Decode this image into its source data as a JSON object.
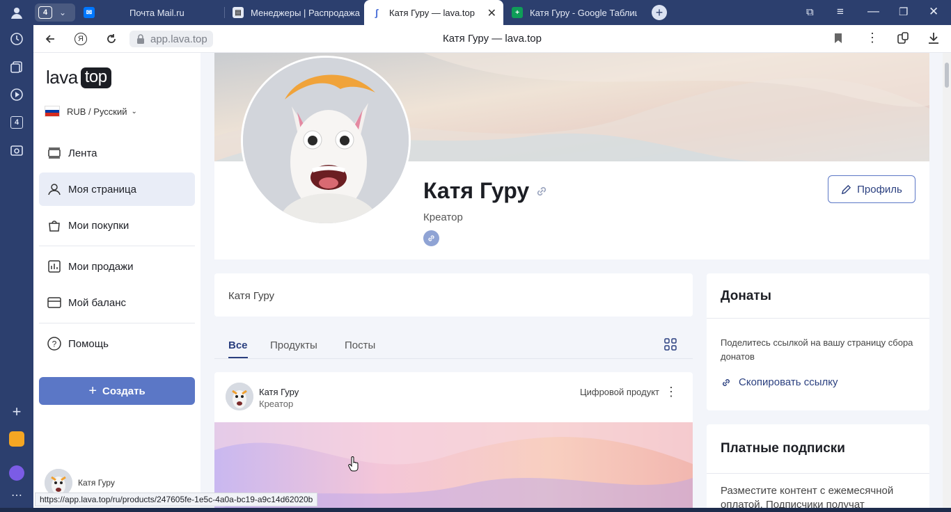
{
  "browser": {
    "tab_count": "4",
    "tabs": [
      {
        "label": "Почта Mail.ru",
        "icon": "mail-ru-icon",
        "color": "#0077ff"
      },
      {
        "label": "Менеджеры | Распродажа",
        "icon": "document-icon",
        "color": "#555555"
      },
      {
        "label": "Катя Гуру — lava.top",
        "icon": "lava-icon",
        "color": "#4a6fd8"
      },
      {
        "label": "Катя Гуру - Google Таблицы",
        "icon": "sheets-icon",
        "color": "#0f9d58"
      }
    ],
    "url": "app.lava.top",
    "page_title": "Катя Гуру — lava.top",
    "status_url": "https://app.lava.top/ru/products/247605fe-1e5c-4a0a-bc19-a9c14d62020b"
  },
  "sidebar": {
    "logo_left": "lava",
    "logo_right": "top",
    "locale": "RUB / Русский",
    "items": [
      {
        "label": "Лента",
        "icon": "feed-icon"
      },
      {
        "label": "Моя страница",
        "icon": "user-icon"
      },
      {
        "label": "Мои покупки",
        "icon": "bag-icon"
      },
      {
        "label": "Мои продажи",
        "icon": "chart-icon"
      },
      {
        "label": "Мой баланс",
        "icon": "wallet-icon"
      },
      {
        "label": "Помощь",
        "icon": "help-icon"
      }
    ],
    "create_label": "Создать",
    "user_name": "Катя Гуру"
  },
  "profile": {
    "name": "Катя Гуру",
    "role": "Креатор",
    "edit_button": "Профиль"
  },
  "about": {
    "text": "Катя Гуру"
  },
  "content_tabs": [
    "Все",
    "Продукты",
    "Посты"
  ],
  "post": {
    "author": "Катя Гуру",
    "role": "Креатор",
    "type": "Цифровой продукт"
  },
  "donations": {
    "title": "Донаты",
    "text": "Поделитесь ссылкой на вашу страницу сбора донатов",
    "copy_link": "Скопировать ссылку"
  },
  "subscriptions": {
    "title": "Платные подписки",
    "text": "Разместите контент с ежемесячной оплатой. Подписчики получат"
  },
  "colors": {
    "accent": "#5b77c6",
    "accent_dark": "#2a3f7f",
    "browser_chrome": "#2c3f6e"
  }
}
